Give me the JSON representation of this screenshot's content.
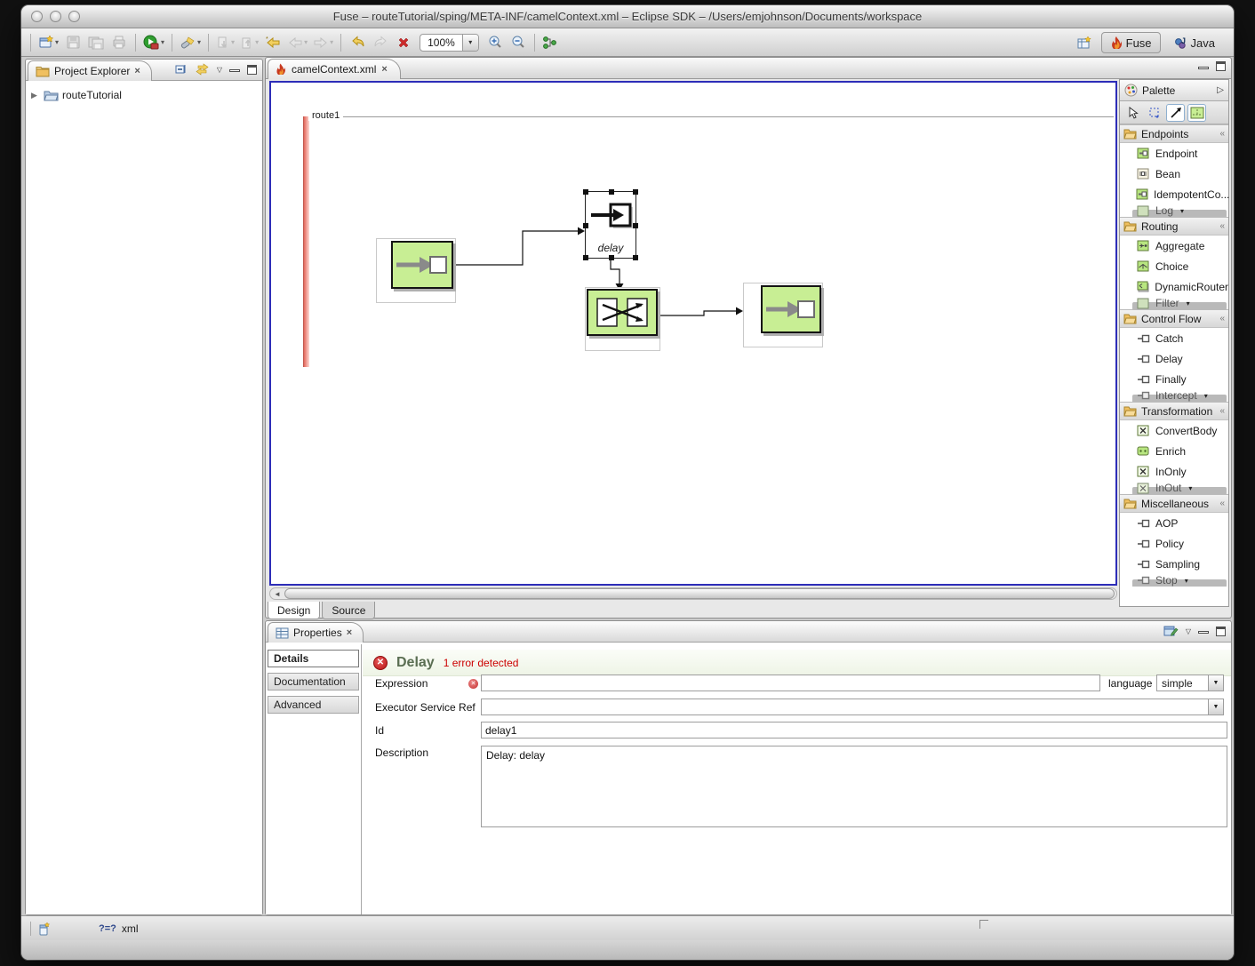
{
  "window": {
    "title": "Fuse – routeTutorial/sping/META-INF/camelContext.xml – Eclipse SDK – /Users/emjohnson/Documents/workspace"
  },
  "toolbar": {
    "zoom_value": "100%",
    "perspectives": {
      "fuse": "Fuse",
      "java": "Java"
    }
  },
  "project_explorer": {
    "title": "Project Explorer",
    "items": [
      {
        "label": "routeTutorial"
      }
    ]
  },
  "editor": {
    "tab_label": "camelContext.xml",
    "route_label": "route1",
    "delay_node_label": "delay",
    "bottom_tabs": {
      "design": "Design",
      "source": "Source"
    }
  },
  "palette": {
    "title": "Palette",
    "sections": [
      {
        "label": "Endpoints",
        "items": [
          "Endpoint",
          "Bean",
          "IdempotentCo...",
          "Log"
        ]
      },
      {
        "label": "Routing",
        "items": [
          "Aggregate",
          "Choice",
          "DynamicRouter",
          "Filter"
        ]
      },
      {
        "label": "Control Flow",
        "items": [
          "Catch",
          "Delay",
          "Finally",
          "Intercept"
        ]
      },
      {
        "label": "Transformation",
        "items": [
          "ConvertBody",
          "Enrich",
          "InOnly",
          "InOut"
        ]
      },
      {
        "label": "Miscellaneous",
        "items": [
          "AOP",
          "Policy",
          "Sampling",
          "Stop"
        ]
      }
    ]
  },
  "properties": {
    "tab_label": "Properties",
    "side_tabs": {
      "details": "Details",
      "documentation": "Documentation",
      "advanced": "Advanced"
    },
    "header": {
      "title": "Delay",
      "error_text": "1 error detected"
    },
    "fields": {
      "expression": {
        "label": "Expression",
        "value": "",
        "language_label": "language",
        "language_value": "simple"
      },
      "executor": {
        "label": "Executor Service Ref",
        "value": ""
      },
      "id": {
        "label": "Id",
        "value": "delay1"
      },
      "description": {
        "label": "Description",
        "value": "Delay: delay"
      }
    }
  },
  "status_bar": {
    "xml_icon": "?=?",
    "xml_label": "xml"
  },
  "colors": {
    "node_green": "#c8ee94",
    "error_red": "#cc0000",
    "canvas_border_blue": "#2d2db8",
    "route_error_bar": "#e2685c"
  }
}
